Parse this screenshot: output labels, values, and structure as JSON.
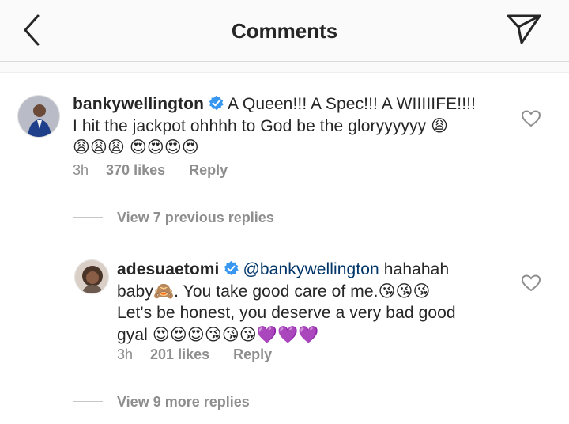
{
  "header": {
    "title": "Comments",
    "back_icon": "chevron-left-icon",
    "send_icon": "paper-plane-icon",
    "background": "#fafafa"
  },
  "comments": [
    {
      "username": "bankywellington",
      "verified": true,
      "text_line1": "A Queen!!! A Spec!!! A WIIIIIFE!!!!",
      "text_line2": "I hit the jackpot ohhhh to God be the gloryyyyyy 😩",
      "text_line3": "😩😩😩 😍😍😍😍",
      "time": "3h",
      "likes": "370 likes",
      "reply_label": "Reply"
    },
    {
      "username": "adesuaetomi",
      "verified": true,
      "mention": "@bankywellington",
      "text_line1_rest": " hahahah",
      "text_line2": "baby🙈. You take good care of me.😘😘😘",
      "text_line3": "Let's be honest, you deserve a very bad good",
      "text_line4": "gyal 😍😍😍😘😘😘💜💜💜",
      "time": "3h",
      "likes": "201 likes",
      "reply_label": "Reply"
    }
  ],
  "replies_links": {
    "previous": "View 7 previous replies",
    "more": "View 9 more replies"
  },
  "colors": {
    "text": "#262626",
    "muted": "#8e8e8e",
    "mention": "#003569",
    "verified": "#3897f0",
    "divider": "#dbdbdb"
  }
}
